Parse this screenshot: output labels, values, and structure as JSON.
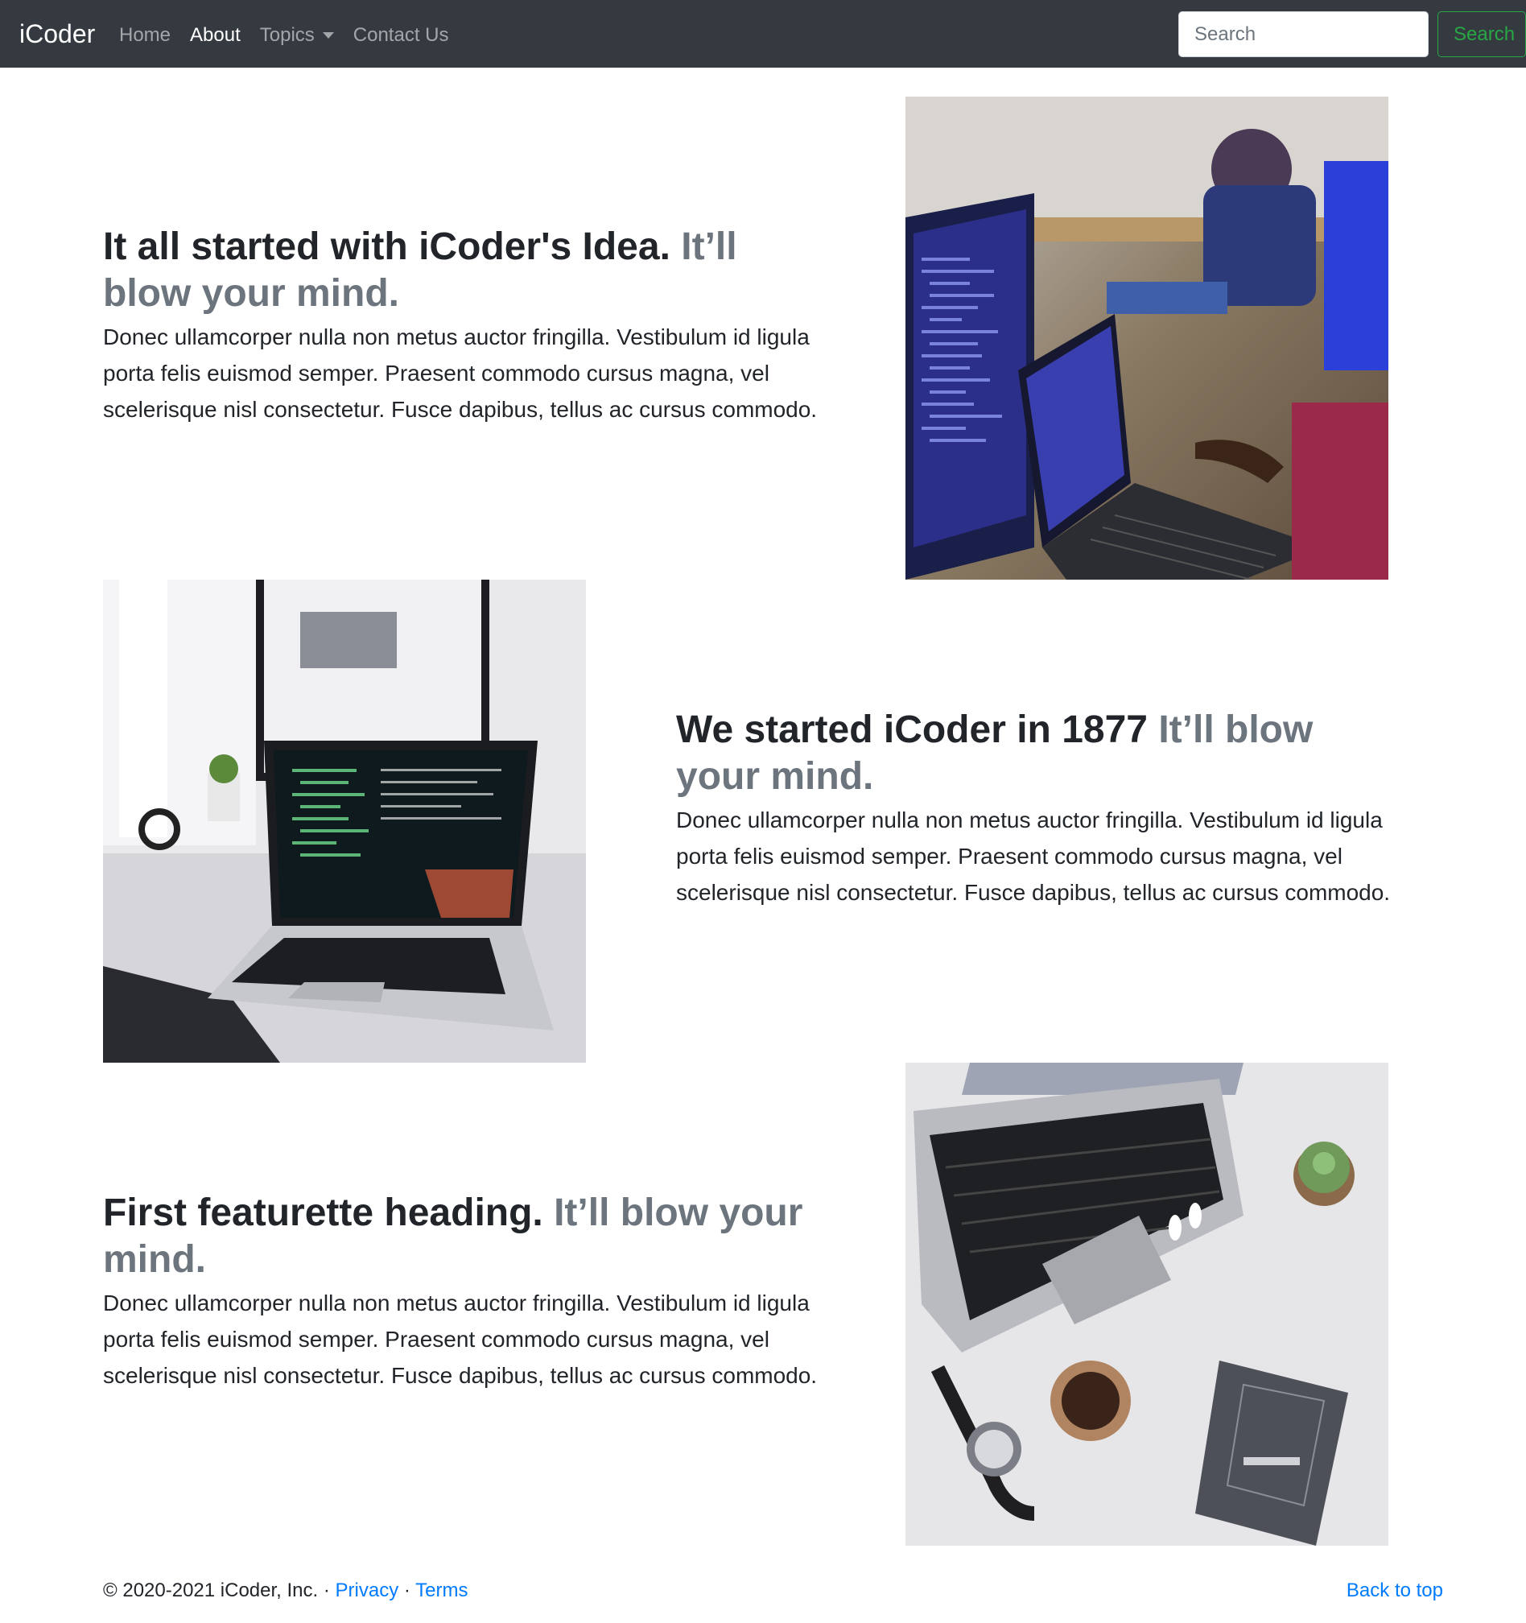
{
  "navbar": {
    "brand": "iCoder",
    "links": [
      {
        "label": "Home"
      },
      {
        "label": "About"
      },
      {
        "label": "Topics"
      },
      {
        "label": "Contact Us"
      }
    ],
    "search": {
      "placeholder": "Search",
      "button_label": "Search"
    }
  },
  "featurettes": [
    {
      "heading": "It all started with iCoder's Idea.",
      "heading_muted": "It’ll blow your mind.",
      "lead": "Donec ullamcorper nulla non metus auctor fringilla. Vestibulum id ligula porta felis euismod semper. Praesent commodo cursus magna, vel scelerisque nisl consectetur. Fusce dapibus, tellus ac cursus commodo."
    },
    {
      "heading": "We started iCoder in 1877",
      "heading_muted": "It’ll blow your mind.",
      "lead": "Donec ullamcorper nulla non metus auctor fringilla. Vestibulum id ligula porta felis euismod semper. Praesent commodo cursus magna, vel scelerisque nisl consectetur. Fusce dapibus, tellus ac cursus commodo."
    },
    {
      "heading": "First featurette heading.",
      "heading_muted": "It’ll blow your mind.",
      "lead": "Donec ullamcorper nulla non metus auctor fringilla. Vestibulum id ligula porta felis euismod semper. Praesent commodo cursus magna, vel scelerisque nisl consectetur. Fusce dapibus, tellus ac cursus commodo."
    }
  ],
  "footer": {
    "copyright": "© 2020-2021 iCoder, Inc. ·",
    "privacy": "Privacy",
    "separator": "·",
    "terms": "Terms",
    "back_to_top": "Back to top"
  },
  "colors": {
    "navbar_bg": "#343a40",
    "link": "#007bff",
    "success": "#28a745",
    "muted": "#6c757d"
  }
}
